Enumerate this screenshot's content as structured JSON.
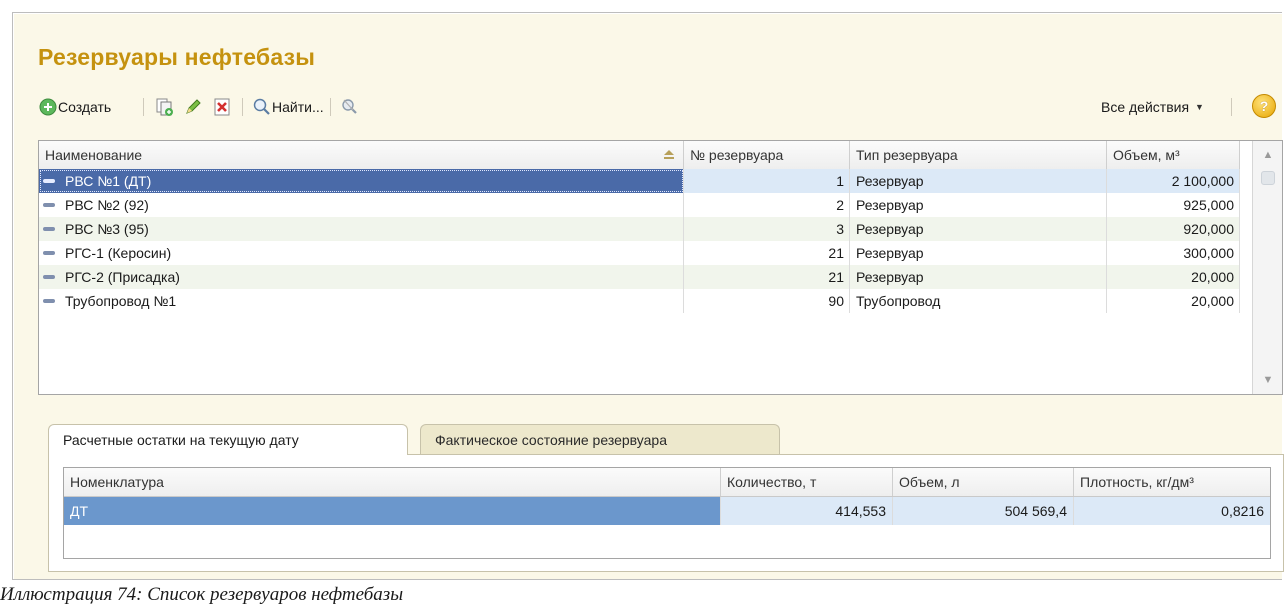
{
  "window": {
    "title": "Резервуары нефтебазы"
  },
  "toolbar": {
    "create_label": "Создать",
    "find_label": "Найти...",
    "all_actions_label": "Все действия",
    "help_label": "?",
    "icons": [
      "plus-circle-icon",
      "copy-icon",
      "edit-pencil-icon",
      "delete-icon",
      "search-icon",
      "filter-off-icon",
      "chevron-down-icon",
      "help-icon"
    ]
  },
  "table": {
    "columns": [
      "Наименование",
      "№ резервуара",
      "Тип резервуара",
      "Объем, м³"
    ],
    "rows": [
      {
        "name": "РВС №1 (ДТ)",
        "number": "1",
        "type": "Резервуар",
        "volume": "2 100,000"
      },
      {
        "name": "РВС №2 (92)",
        "number": "2",
        "type": "Резервуар",
        "volume": "925,000"
      },
      {
        "name": "РВС №3 (95)",
        "number": "3",
        "type": "Резервуар",
        "volume": "920,000"
      },
      {
        "name": "РГС-1 (Керосин)",
        "number": "21",
        "type": "Резервуар",
        "volume": "300,000"
      },
      {
        "name": "РГС-2 (Присадка)",
        "number": "21",
        "type": "Резервуар",
        "volume": "20,000"
      },
      {
        "name": "Трубопровод №1",
        "number": "90",
        "type": "Трубопровод",
        "volume": "20,000"
      }
    ],
    "selected_row": 0
  },
  "tabs": [
    {
      "label": "Расчетные остатки на текущую дату",
      "active": true
    },
    {
      "label": "Фактическое состояние резервуара",
      "active": false
    }
  ],
  "balances": {
    "columns": [
      "Номенклатура",
      "Количество, т",
      "Объем, л",
      "Плотность, кг/дм³"
    ],
    "rows": [
      {
        "item": "ДТ",
        "quantity": "414,553",
        "volume": "504 569,4",
        "density": "0,8216"
      }
    ]
  },
  "caption": "Иллюстрация 74: Список резервуаров нефтебазы",
  "colors": {
    "title": "#c5920f",
    "selection": "#4a6aa8",
    "selection_light": "#dce9f7",
    "panel_bg": "#fbf8e8"
  }
}
